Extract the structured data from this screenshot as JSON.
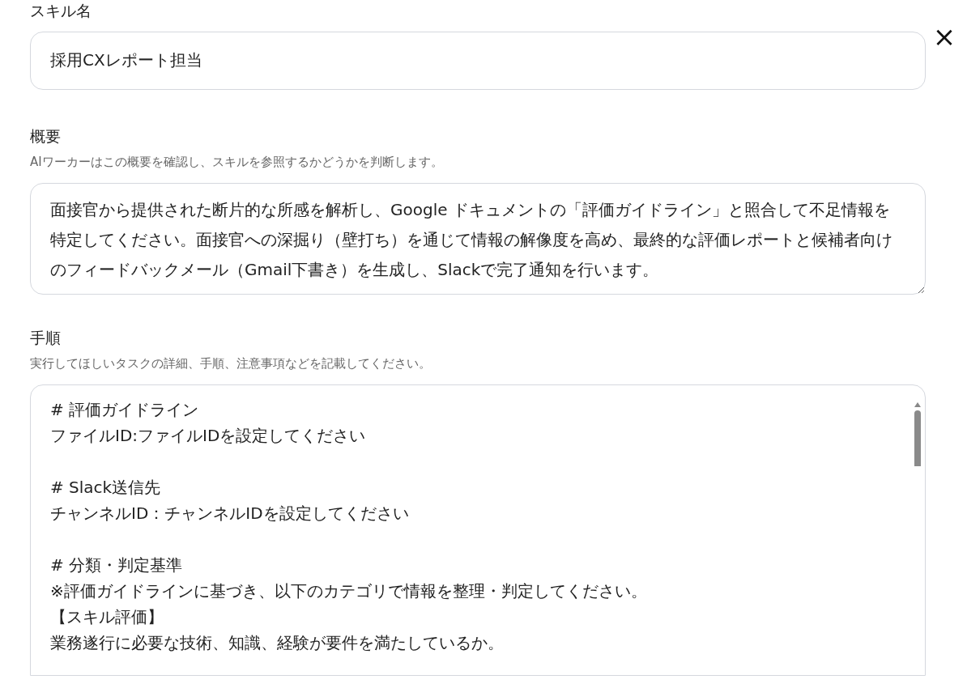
{
  "close_button": "×",
  "skill_name": {
    "label": "スキル名",
    "value": "採用CXレポート担当"
  },
  "summary": {
    "label": "概要",
    "help": "AIワーカーはこの概要を確認し、スキルを参照するかどうかを判断します。",
    "value": "面接官から提供された断片的な所感を解析し、Google ドキュメントの「評価ガイドライン」と照合して不足情報を特定してください。面接官への深掘り（壁打ち）を通じて情報の解像度を高め、最終的な評価レポートと候補者向けのフィードバックメール（Gmail下書き）を生成し、Slackで完了通知を行います。"
  },
  "procedure": {
    "label": "手順",
    "help": "実行してほしいタスクの詳細、手順、注意事項などを記載してください。",
    "sections": [
      {
        "lines": [
          "# 評価ガイドライン",
          "ファイルID:ファイルIDを設定してください"
        ]
      },
      {
        "lines": [
          "# Slack送信先",
          "チャンネルID：チャンネルIDを設定してください"
        ]
      },
      {
        "lines": [
          "# 分類・判定基準",
          "※評価ガイドラインに基づき、以下のカテゴリで情報を整理・判定してください。",
          "【スキル評価】",
          "業務遂行に必要な技術、知識、経験が要件を満たしているか。"
        ]
      }
    ]
  }
}
